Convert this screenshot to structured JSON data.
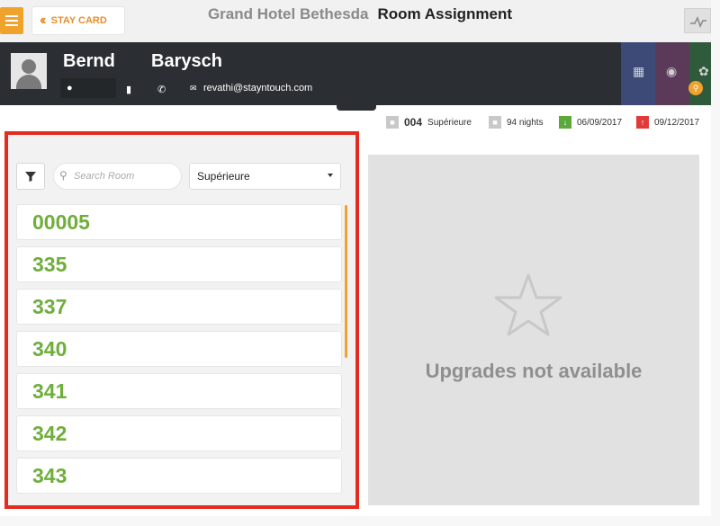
{
  "header": {
    "menu_icon": "hamburger-icon",
    "back_label": "STAY CARD",
    "hotel_name": "Grand Hotel Bethesda",
    "page_title": "Room Assignment",
    "activity_icon": "activity-icon"
  },
  "guest": {
    "first_name": "Bernd",
    "last_name": "Barysch",
    "email": "revathi@stayntouch.com"
  },
  "stay": {
    "room_number": "004",
    "room_type": "Supérieure",
    "nights": "94 nights",
    "arrival": "06/09/2017",
    "departure": "09/12/2017"
  },
  "room_search": {
    "placeholder": "Search Room",
    "room_type_selected": "Supérieure"
  },
  "rooms": [
    "00005",
    "335",
    "337",
    "340",
    "341",
    "342",
    "343"
  ],
  "upgrades": {
    "message": "Upgrades not available"
  },
  "colors": {
    "accent": "#f0a32c",
    "room_number": "#6fae3b",
    "guest_bar": "#2b2f33",
    "highlight_frame": "#e32b1f",
    "arrival": "#5aa93a",
    "departure": "#e03a3a"
  }
}
